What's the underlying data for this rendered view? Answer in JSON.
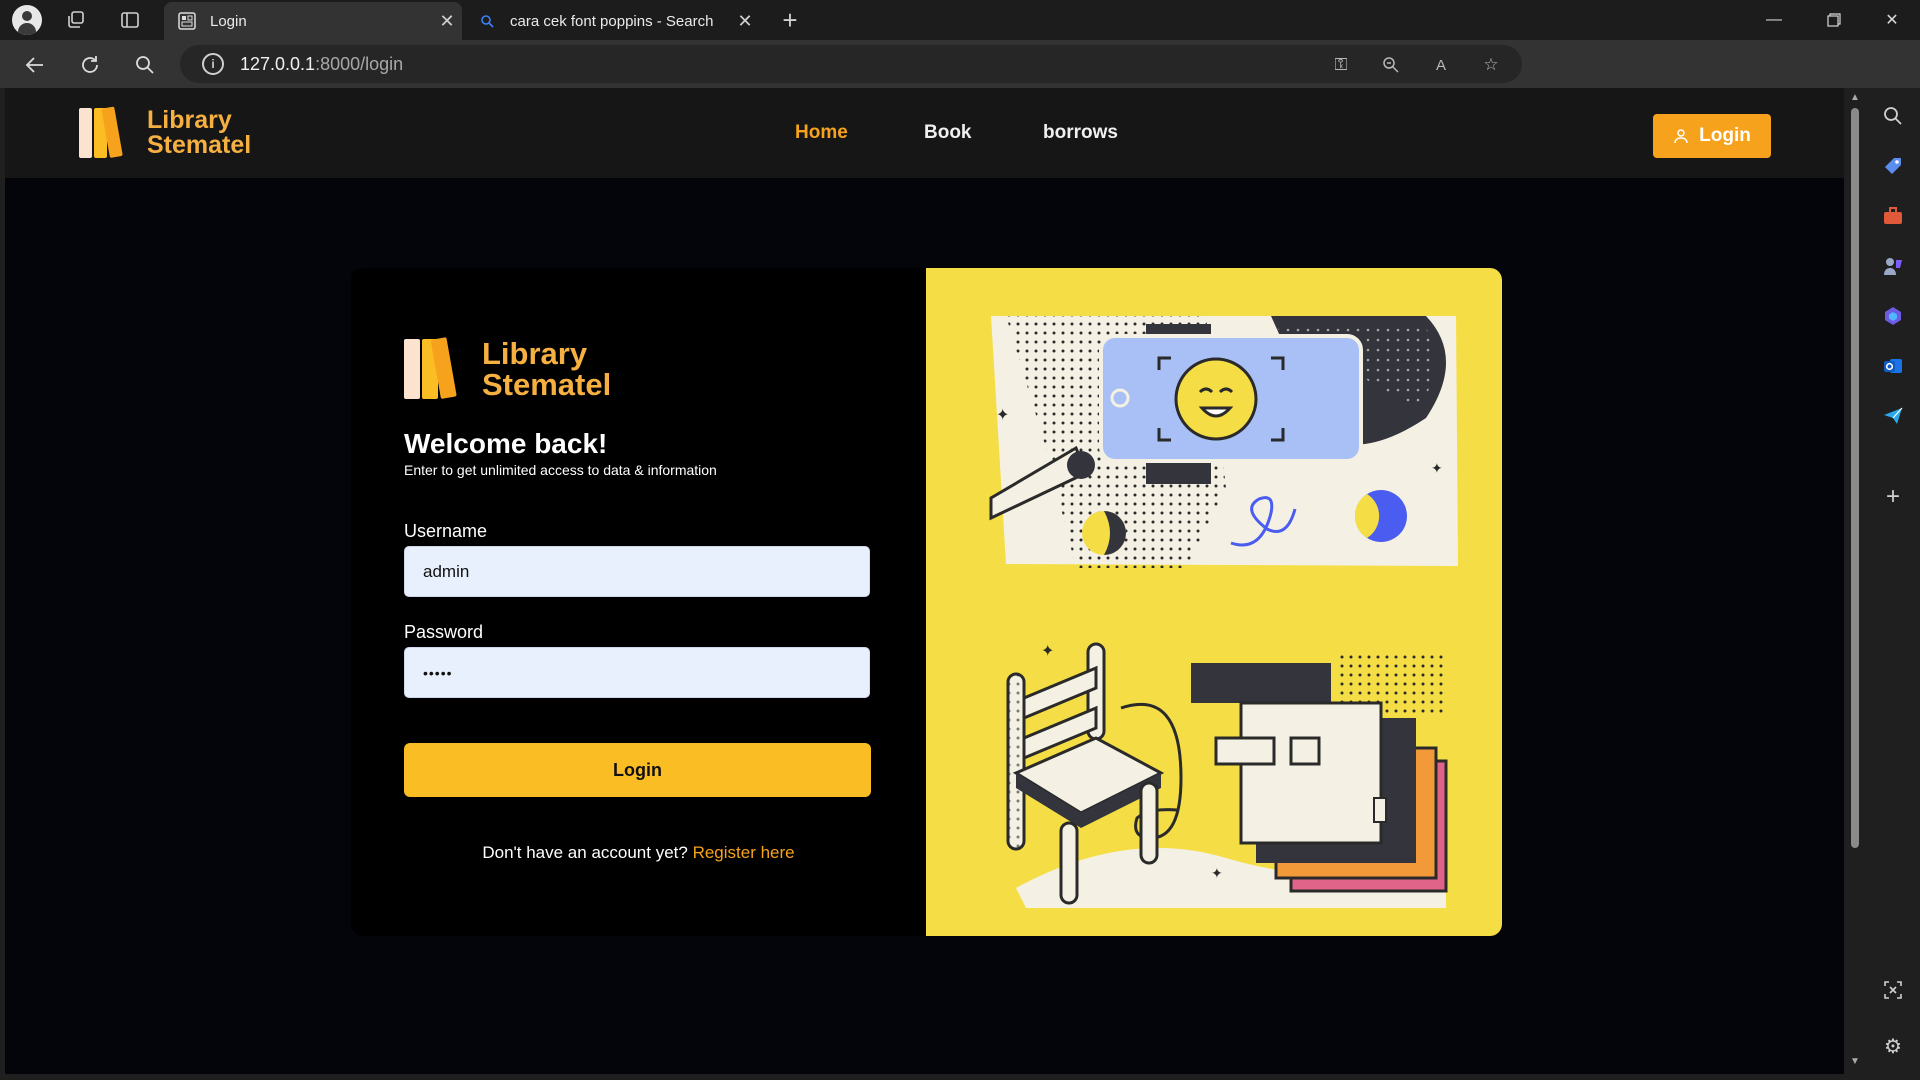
{
  "browser": {
    "tabs": [
      {
        "title": "Login",
        "active": true
      },
      {
        "title": "cara cek font poppins - Search",
        "active": false
      }
    ],
    "url": {
      "host": "127.0.0.1",
      "path": ":8000/login"
    }
  },
  "site": {
    "logo": {
      "line1": "Library",
      "line2": "Stematel"
    },
    "nav": [
      {
        "label": "Home",
        "active": true
      },
      {
        "label": "Book",
        "active": false
      },
      {
        "label": "borrows",
        "active": false
      }
    ],
    "login_button": "Login"
  },
  "login": {
    "logo": {
      "line1": "Library",
      "line2": "Stematel"
    },
    "heading": "Welcome back!",
    "subheading": "Enter to get unlimited access to data & information",
    "username_label": "Username",
    "username_value": "admin",
    "password_label": "Password",
    "password_value": "•••••",
    "submit_label": "Login",
    "register_prompt": "Don't have an account yet?",
    "register_link": "Register here"
  },
  "colors": {
    "accent": "#f6a21c",
    "button": "#fbbd24",
    "illustration_bg": "#f5de45",
    "illustration_blue": "#a8c0f5",
    "illustration_dark": "#33343c"
  }
}
